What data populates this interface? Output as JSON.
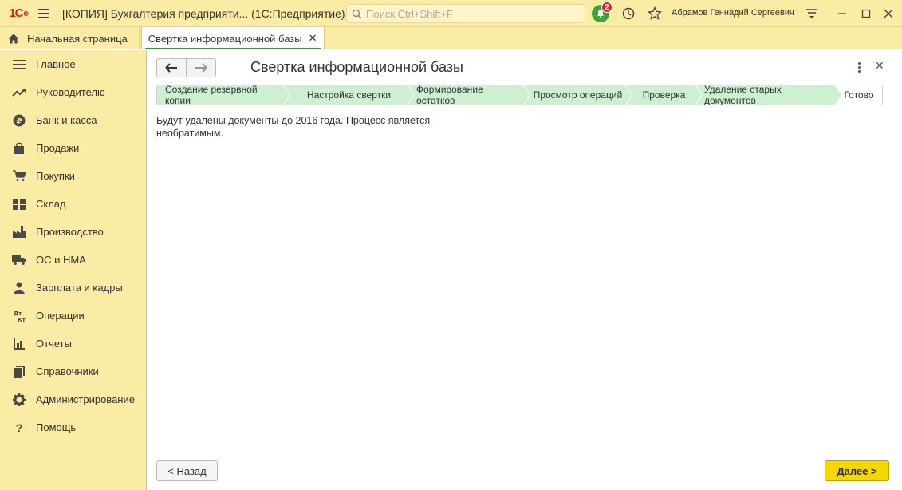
{
  "titlebar": {
    "logo_text": "1С",
    "app_title": "[КОПИЯ] Бухгалтерия предприяти...  (1С:Предприятие)",
    "search_placeholder": "Поиск Ctrl+Shift+F",
    "notification_count": "2",
    "user_name": "Абрамов Геннадий Сергеевич",
    "accent_color": "#fbeca5"
  },
  "tabs": {
    "home_label": "Начальная страница",
    "active_label": "Свертка информационной базы"
  },
  "sidebar": {
    "items": [
      {
        "label": "Главное",
        "icon": "menu-lines-icon"
      },
      {
        "label": "Руководителю",
        "icon": "trend-icon"
      },
      {
        "label": "Банк и касса",
        "icon": "ruble-coin-icon"
      },
      {
        "label": "Продажи",
        "icon": "bag-icon"
      },
      {
        "label": "Покупки",
        "icon": "cart-icon"
      },
      {
        "label": "Склад",
        "icon": "warehouse-icon"
      },
      {
        "label": "Производство",
        "icon": "factory-icon"
      },
      {
        "label": "ОС и НМА",
        "icon": "truck-icon"
      },
      {
        "label": "Зарплата и кадры",
        "icon": "person-icon"
      },
      {
        "label": "Операции",
        "icon": "dt-kt-icon"
      },
      {
        "label": "Отчеты",
        "icon": "bar-chart-icon"
      },
      {
        "label": "Справочники",
        "icon": "books-icon"
      },
      {
        "label": "Администрирование",
        "icon": "gear-icon"
      },
      {
        "label": "Помощь",
        "icon": "question-icon"
      }
    ]
  },
  "main": {
    "title": "Свертка информационной базы",
    "steps": [
      "Создание резервной копии",
      "Настройка свертки",
      "Формирование остатков",
      "Просмотр операций",
      "Проверка",
      "Удаление старых документов",
      "Готово"
    ],
    "message": "Будут удалены документы до 2016 года. Процесс является необратимым.",
    "back_label": "< Назад",
    "next_label": "Далее >",
    "completed_step_color": "#cdf0d2",
    "primary_button_color": "#f7d700"
  }
}
